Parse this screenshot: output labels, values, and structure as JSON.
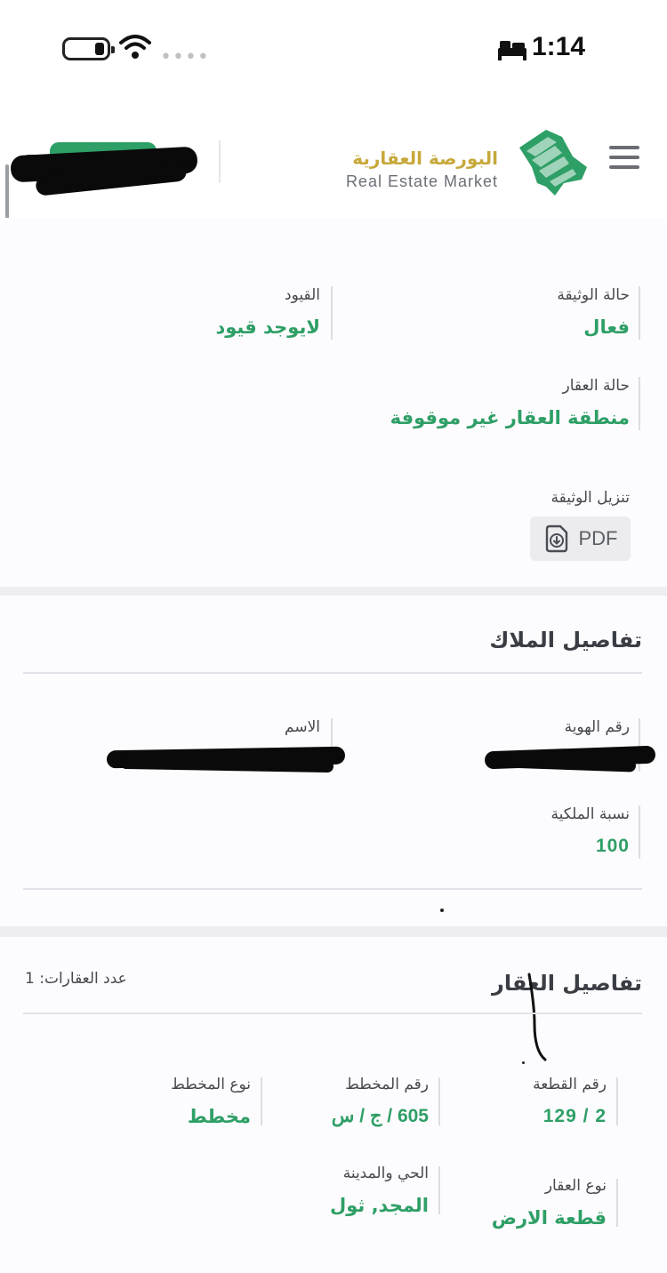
{
  "status_bar": {
    "time": "1:14",
    "signal": "••••",
    "icons": [
      "battery-icon",
      "wifi-icon",
      "cellular-signal-icon",
      "bed-icon"
    ]
  },
  "header": {
    "logo_ar": "البورصة العقارية",
    "logo_en": "Real Estate Market",
    "icons": [
      "menu-icon",
      "logo-mark-icon",
      "chevron-down-icon"
    ],
    "colors": {
      "gold": "#c7a83a",
      "green": "#2e9f66"
    }
  },
  "document": {
    "status_label": "حالة الوثيقة",
    "status_value": "فعال",
    "restrictions_label": "القيود",
    "restrictions_value": "لايوجد قيود",
    "property_status_label": "حالة العقار",
    "property_status_value": "منطقة العقار غير موقوفة",
    "download_label": "تنزيل الوثيقة",
    "pdf_button": "PDF"
  },
  "owners": {
    "title": "تفاصيل الملاك",
    "id_label": "رقم الهوية",
    "name_label": "الاسم",
    "ownership_label": "نسبة الملكية",
    "ownership_value": "100"
  },
  "property": {
    "title": "تفاصيل العقار",
    "count_label": "عدد العقارات: 1",
    "plot_number_label": "رقم القطعة",
    "plot_number_value": "2 / 129",
    "plan_number_label": "رقم المخطط",
    "plan_number_value": "605 / ج / س",
    "plan_type_label": "نوع المخطط",
    "plan_type_value": "مخطط",
    "property_type_label": "نوع العقار",
    "property_type_value": "قطعة الارض",
    "district_label": "الحي والمدينة",
    "district_value": "المجد, ثول"
  }
}
